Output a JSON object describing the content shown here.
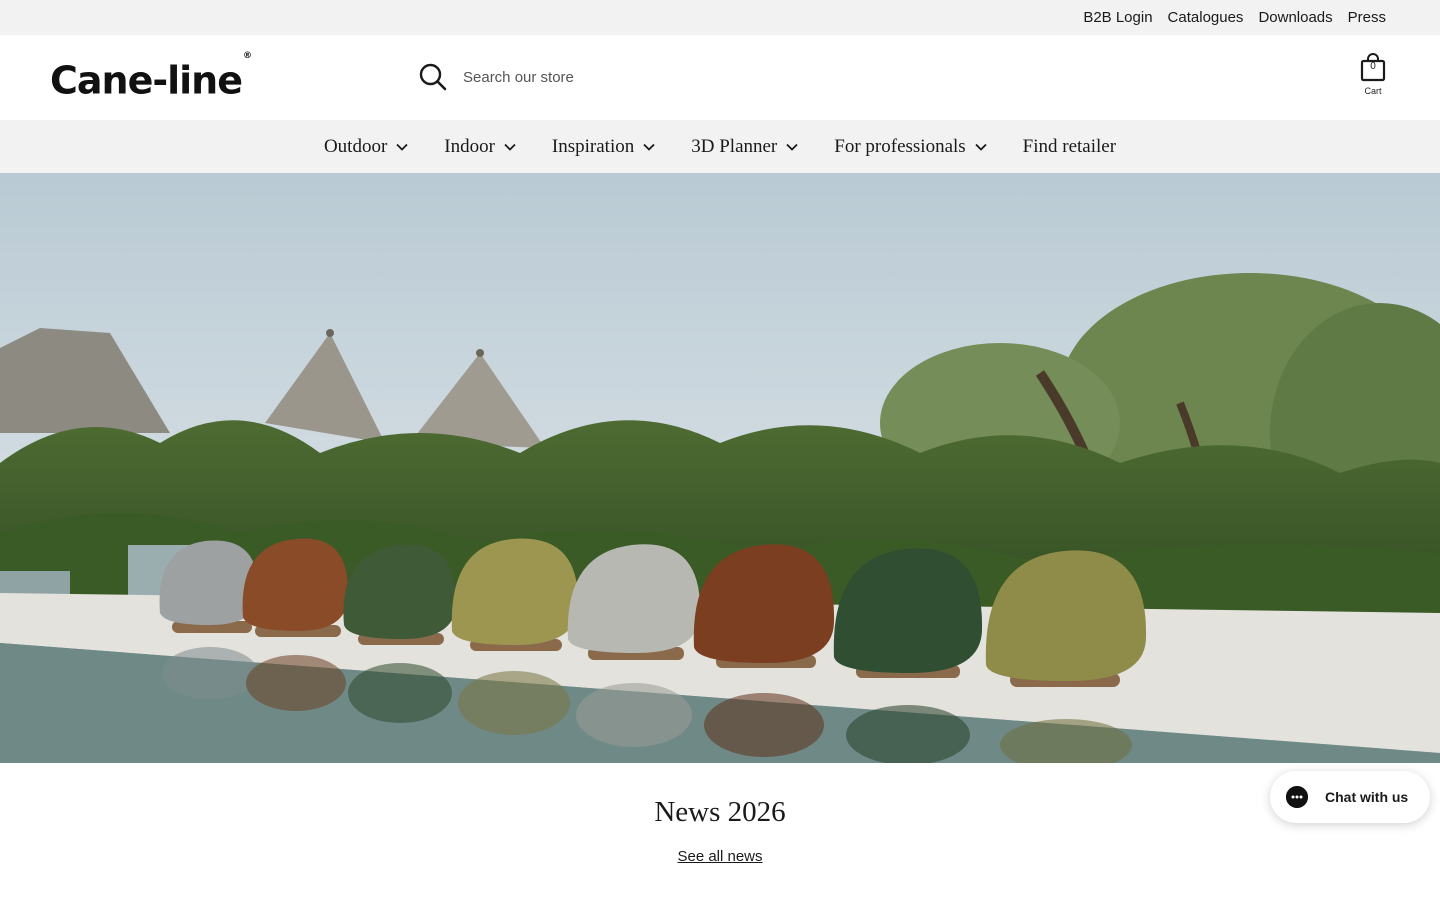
{
  "utility_links": [
    {
      "label": "B2B Login"
    },
    {
      "label": "Catalogues"
    },
    {
      "label": "Downloads"
    },
    {
      "label": "Press"
    }
  ],
  "header": {
    "logo_text": "Cane-line",
    "logo_mark": "®",
    "search_placeholder": "Search our store",
    "search_icon": "search-icon",
    "cart_count": "0",
    "cart_label": "Cart",
    "cart_icon": "shopping-bag-icon"
  },
  "nav": [
    {
      "label": "Outdoor",
      "has_dropdown": true
    },
    {
      "label": "Indoor",
      "has_dropdown": true
    },
    {
      "label": "Inspiration",
      "has_dropdown": true
    },
    {
      "label": "3D Planner",
      "has_dropdown": true
    },
    {
      "label": "For professionals",
      "has_dropdown": true
    },
    {
      "label": "Find retailer",
      "has_dropdown": false
    }
  ],
  "news": {
    "title": "News 2026",
    "link_label": "See all news"
  },
  "chat": {
    "label": "Chat with us",
    "icon": "chat-icon"
  },
  "colors": {
    "bar_background": "#f2f2f2",
    "text": "#1a1a1a",
    "sky": "#c9d5dc",
    "foliage": "#3d5a2a"
  }
}
